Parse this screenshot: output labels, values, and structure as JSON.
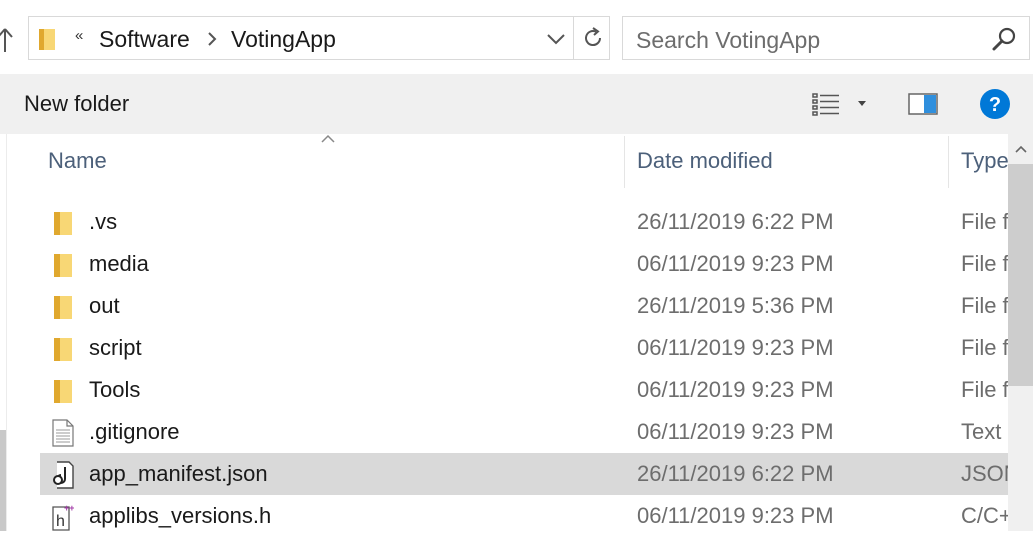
{
  "address_bar": {
    "overflow_chevrons": "«",
    "breadcrumbs": [
      "Software",
      "VotingApp"
    ]
  },
  "search": {
    "placeholder": "Search VotingApp"
  },
  "toolbar": {
    "new_folder_label": "New folder"
  },
  "columns": {
    "name": "Name",
    "date_modified": "Date modified",
    "type": "Type"
  },
  "files": [
    {
      "name": ".vs",
      "date": "26/11/2019 6:22 PM",
      "type": "File folder",
      "icon": "folder-icon"
    },
    {
      "name": "media",
      "date": "06/11/2019 9:23 PM",
      "type": "File folder",
      "icon": "folder-icon"
    },
    {
      "name": "out",
      "date": "26/11/2019 5:36 PM",
      "type": "File folder",
      "icon": "folder-icon"
    },
    {
      "name": "script",
      "date": "06/11/2019 9:23 PM",
      "type": "File folder",
      "icon": "folder-icon"
    },
    {
      "name": "Tools",
      "date": "06/11/2019 9:23 PM",
      "type": "File folder",
      "icon": "folder-icon"
    },
    {
      "name": ".gitignore",
      "date": "06/11/2019 9:23 PM",
      "type": "Text Document",
      "icon": "text-file-icon"
    },
    {
      "name": "app_manifest.json",
      "date": "26/11/2019 6:22 PM",
      "type": "JSON File",
      "icon": "json-file-icon",
      "selected": true
    },
    {
      "name": "applibs_versions.h",
      "date": "06/11/2019 9:23 PM",
      "type": "C/C++ Header",
      "icon": "header-file-icon"
    }
  ],
  "colors": {
    "folder_yellow": "#f8d775",
    "folder_dark": "#e0a82e",
    "help_blue": "#0078d7",
    "header_text": "#4c607a",
    "selected_row": "#d9d9d9",
    "toolbar_bg": "#f0f0f0"
  }
}
